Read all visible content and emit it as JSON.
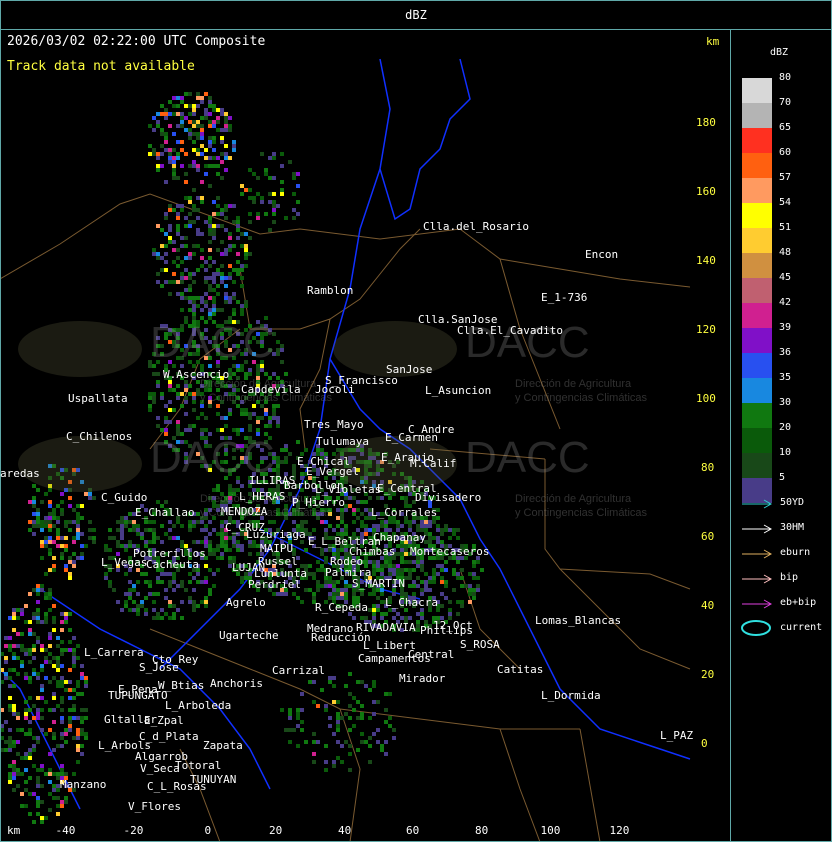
{
  "header": {
    "title": "dBZ"
  },
  "map": {
    "timestamp": "2026/03/02 02:22:00 UTC Composite",
    "notice": "Track data not available",
    "unit_right": "km",
    "unit_bottom": "km",
    "y_ticks": [
      "180",
      "160",
      "140",
      "120",
      "100",
      "80",
      "60",
      "40",
      "20",
      "0"
    ],
    "x_ticks": [
      "-40",
      "-20",
      "0",
      "20",
      "40",
      "60",
      "80",
      "100",
      "120"
    ],
    "watermark": "DACC",
    "watermark_sub1": "Dirección de Agricultura",
    "watermark_sub2": "y Contingencias Climáticas",
    "places": [
      "Clla.del_Rosario",
      "Encon",
      "E_1-736",
      "Ramblon",
      "Clla.SanJose",
      "Clla.El_Cavadito",
      "S_Francisco",
      "SanJose",
      "L_Asuncion",
      "Uspallata",
      "W.Ascencio",
      "Capdevila",
      "Jocoli",
      "C_Chilenos",
      "Tres_Mayo",
      "C_Andre",
      "Tulumaya",
      "E_Carmen",
      "E_Chical",
      "E_Araujo",
      "M.Calif",
      "ILLIRAS",
      "E_Vergel",
      "Barbollon",
      "C_Guido",
      "P_Hierro",
      "L_Violetas",
      "E_Central",
      "Divisadero",
      "L_HERAS",
      "E_Challao",
      "MENDOZA",
      "C_CRUZ",
      "L_Corrales",
      "Luzuriaga",
      "E_L_Beltran",
      "Chapanay",
      "MAIPU",
      "Chimbas",
      "Potrerillos",
      "Cacheuta",
      "Russel",
      "Rodeo",
      "Palmira",
      "Montecaseros",
      "L_Vegas",
      "LUJAN",
      "Lunlunta",
      "S_MARTIN",
      "Perdriel",
      "Agrelo",
      "R_Cepeda",
      "Reducción",
      "Ugarteche",
      "RIVADAVIA",
      "L_Chacra",
      "12_Oct",
      "Lomas_Blancas",
      "Medrano",
      "L_Libert",
      "Phillips",
      "S_ROSA",
      "Campamentos",
      "Central",
      "L_Carrera",
      "Cto_Rey",
      "S_Jose",
      "Carrizal",
      "Catitas",
      "E_Pena",
      "Anchoris",
      "W_Btias",
      "TUPUNGATO",
      "Mirador",
      "L_Dormida",
      "L_Arboleda",
      "Gltallar",
      "E_Zpal",
      "L_Arbols",
      "C_d_Plata",
      "Zapata",
      "Algarrob",
      "V_Seca",
      "Totoral",
      "TUNUYAN",
      "Manzano",
      "C_L_Rosas",
      "V_Flores",
      "L_PAZ",
      "aredas"
    ]
  },
  "legend": {
    "title": "dBZ",
    "scale": [
      {
        "label": "80",
        "color": "#d8d8d8"
      },
      {
        "label": "70",
        "color": "#b4b4b4"
      },
      {
        "label": "65",
        "color": "#ff3020"
      },
      {
        "label": "60",
        "color": "#ff6010"
      },
      {
        "label": "57",
        "color": "#ff9a60"
      },
      {
        "label": "54",
        "color": "#ffff00"
      },
      {
        "label": "51",
        "color": "#ffcc30"
      },
      {
        "label": "48",
        "color": "#d09040"
      },
      {
        "label": "45",
        "color": "#c06070"
      },
      {
        "label": "42",
        "color": "#d02090"
      },
      {
        "label": "39",
        "color": "#8010c8"
      },
      {
        "label": "36",
        "color": "#2850f0"
      },
      {
        "label": "35",
        "color": "#1888e0"
      },
      {
        "label": "30",
        "color": "#107810"
      },
      {
        "label": "20",
        "color": "#0a5a0a"
      },
      {
        "label": "10",
        "color": "#184818"
      },
      {
        "label": "5",
        "color": "#483c88"
      }
    ],
    "tracks": [
      {
        "label": "50YD",
        "color": "#30d0d0"
      },
      {
        "label": "30HM",
        "color": "#ffffff"
      },
      {
        "label": "eburn",
        "color": "#e0b060"
      },
      {
        "label": "bip",
        "color": "#ffc0c0"
      },
      {
        "label": "eb+bip",
        "color": "#e040e0"
      }
    ],
    "current_label": "current",
    "current_color": "#30e0e0"
  }
}
